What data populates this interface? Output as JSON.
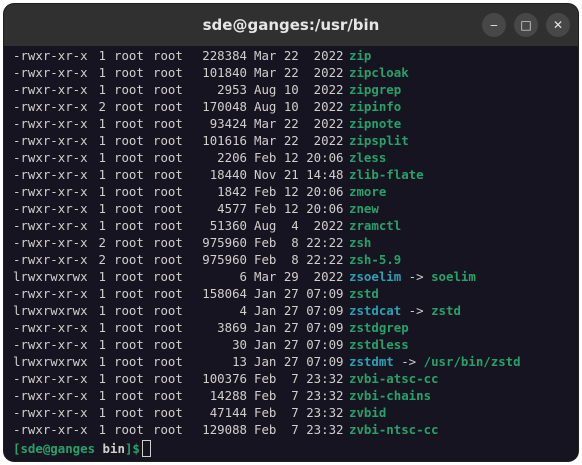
{
  "window": {
    "title": "sde@ganges:/usr/bin",
    "minimize_label": "‒",
    "maximize_label": "□",
    "close_label": "✕"
  },
  "colors": {
    "background": "#171421",
    "text": "#d0cfcc",
    "executable": "#26a269",
    "symlink": "#2aa1b3",
    "titlebar": "#303030"
  },
  "listing": [
    {
      "perm": "-rwxr-xr-x",
      "links": "1",
      "owner": "root",
      "group": "root",
      "size": "228384",
      "date": "Mar 22  2022",
      "name": "zip",
      "type": "exec"
    },
    {
      "perm": "-rwxr-xr-x",
      "links": "1",
      "owner": "root",
      "group": "root",
      "size": "101840",
      "date": "Mar 22  2022",
      "name": "zipcloak",
      "type": "exec"
    },
    {
      "perm": "-rwxr-xr-x",
      "links": "1",
      "owner": "root",
      "group": "root",
      "size": "2953",
      "date": "Aug 10  2022",
      "name": "zipgrep",
      "type": "exec"
    },
    {
      "perm": "-rwxr-xr-x",
      "links": "2",
      "owner": "root",
      "group": "root",
      "size": "170048",
      "date": "Aug 10  2022",
      "name": "zipinfo",
      "type": "exec"
    },
    {
      "perm": "-rwxr-xr-x",
      "links": "1",
      "owner": "root",
      "group": "root",
      "size": "93424",
      "date": "Mar 22  2022",
      "name": "zipnote",
      "type": "exec"
    },
    {
      "perm": "-rwxr-xr-x",
      "links": "1",
      "owner": "root",
      "group": "root",
      "size": "101616",
      "date": "Mar 22  2022",
      "name": "zipsplit",
      "type": "exec"
    },
    {
      "perm": "-rwxr-xr-x",
      "links": "1",
      "owner": "root",
      "group": "root",
      "size": "2206",
      "date": "Feb 12 20:06",
      "name": "zless",
      "type": "exec"
    },
    {
      "perm": "-rwxr-xr-x",
      "links": "1",
      "owner": "root",
      "group": "root",
      "size": "18440",
      "date": "Nov 21 14:48",
      "name": "zlib-flate",
      "type": "exec"
    },
    {
      "perm": "-rwxr-xr-x",
      "links": "1",
      "owner": "root",
      "group": "root",
      "size": "1842",
      "date": "Feb 12 20:06",
      "name": "zmore",
      "type": "exec"
    },
    {
      "perm": "-rwxr-xr-x",
      "links": "1",
      "owner": "root",
      "group": "root",
      "size": "4577",
      "date": "Feb 12 20:06",
      "name": "znew",
      "type": "exec"
    },
    {
      "perm": "-rwxr-xr-x",
      "links": "1",
      "owner": "root",
      "group": "root",
      "size": "51360",
      "date": "Aug  4  2022",
      "name": "zramctl",
      "type": "exec"
    },
    {
      "perm": "-rwxr-xr-x",
      "links": "2",
      "owner": "root",
      "group": "root",
      "size": "975960",
      "date": "Feb  8 22:22",
      "name": "zsh",
      "type": "exec"
    },
    {
      "perm": "-rwxr-xr-x",
      "links": "2",
      "owner": "root",
      "group": "root",
      "size": "975960",
      "date": "Feb  8 22:22",
      "name": "zsh-5.9",
      "type": "exec"
    },
    {
      "perm": "lrwxrwxrwx",
      "links": "1",
      "owner": "root",
      "group": "root",
      "size": "6",
      "date": "Mar 29  2022",
      "name": "zsoelim",
      "type": "link",
      "target": "soelim"
    },
    {
      "perm": "-rwxr-xr-x",
      "links": "1",
      "owner": "root",
      "group": "root",
      "size": "158064",
      "date": "Jan 27 07:09",
      "name": "zstd",
      "type": "exec"
    },
    {
      "perm": "lrwxrwxrwx",
      "links": "1",
      "owner": "root",
      "group": "root",
      "size": "4",
      "date": "Jan 27 07:09",
      "name": "zstdcat",
      "type": "link",
      "target": "zstd"
    },
    {
      "perm": "-rwxr-xr-x",
      "links": "1",
      "owner": "root",
      "group": "root",
      "size": "3869",
      "date": "Jan 27 07:09",
      "name": "zstdgrep",
      "type": "exec"
    },
    {
      "perm": "-rwxr-xr-x",
      "links": "1",
      "owner": "root",
      "group": "root",
      "size": "30",
      "date": "Jan 27 07:09",
      "name": "zstdless",
      "type": "exec"
    },
    {
      "perm": "lrwxrwxrwx",
      "links": "1",
      "owner": "root",
      "group": "root",
      "size": "13",
      "date": "Jan 27 07:09",
      "name": "zstdmt",
      "type": "link",
      "target": "/usr/bin/zstd"
    },
    {
      "perm": "-rwxr-xr-x",
      "links": "1",
      "owner": "root",
      "group": "root",
      "size": "100376",
      "date": "Feb  7 23:32",
      "name": "zvbi-atsc-cc",
      "type": "exec"
    },
    {
      "perm": "-rwxr-xr-x",
      "links": "1",
      "owner": "root",
      "group": "root",
      "size": "14288",
      "date": "Feb  7 23:32",
      "name": "zvbi-chains",
      "type": "exec"
    },
    {
      "perm": "-rwxr-xr-x",
      "links": "1",
      "owner": "root",
      "group": "root",
      "size": "47144",
      "date": "Feb  7 23:32",
      "name": "zvbid",
      "type": "exec"
    },
    {
      "perm": "-rwxr-xr-x",
      "links": "1",
      "owner": "root",
      "group": "root",
      "size": "129088",
      "date": "Feb  7 23:32",
      "name": "zvbi-ntsc-cc",
      "type": "exec"
    }
  ],
  "prompt": {
    "open": "[",
    "user_host": "sde@ganges",
    "dir": "bin",
    "close": "]$"
  }
}
